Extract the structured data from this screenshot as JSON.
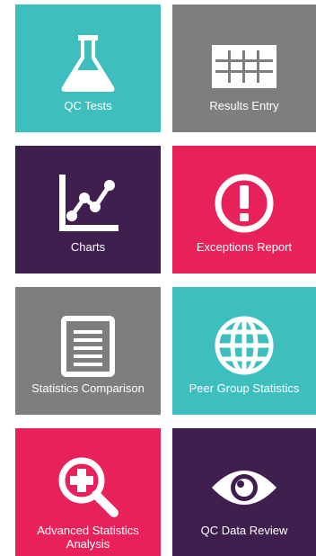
{
  "colors": {
    "teal": "#3ebfbd",
    "gray": "#7e7e7c",
    "purple": "#3f1f4e",
    "pink": "#e8215a",
    "icon": "#ffffff"
  },
  "tiles": [
    {
      "label": "QC Tests",
      "icon": "flask-icon",
      "color": "#3ebfbd"
    },
    {
      "label": "Results Entry",
      "icon": "table-grid-icon",
      "color": "#7e7e7c"
    },
    {
      "label": "Charts",
      "icon": "line-chart-icon",
      "color": "#3f1f4e"
    },
    {
      "label": "Exceptions Report",
      "icon": "exclamation-circle-icon",
      "color": "#e8215a"
    },
    {
      "label": "Statistics Comparison",
      "icon": "document-icon",
      "color": "#7e7e7c"
    },
    {
      "label": "Peer Group Statistics",
      "icon": "globe-icon",
      "color": "#3ebfbd"
    },
    {
      "label": "Advanced Statistics Analysis",
      "icon": "magnify-plus-icon",
      "color": "#e8215a"
    },
    {
      "label": "QC Data Review",
      "icon": "eye-icon",
      "color": "#3f1f4e"
    }
  ]
}
